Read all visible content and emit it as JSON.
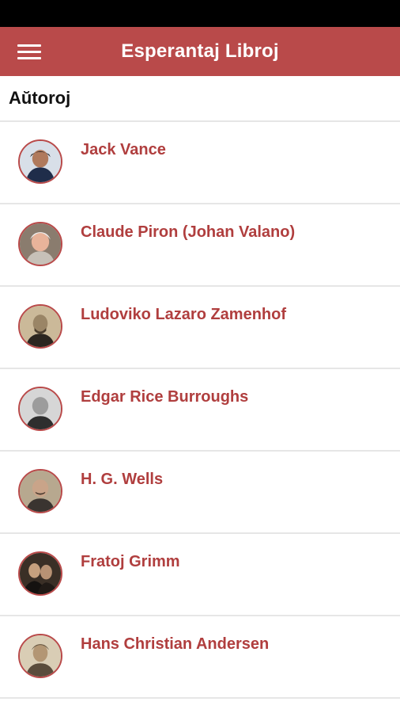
{
  "app": {
    "title": "Esperantaj Libroj",
    "accent_color": "#b94a4a",
    "menu_icon": "hamburger-menu-icon"
  },
  "section": {
    "title": "Aŭtoroj"
  },
  "authors": [
    {
      "name": "Jack Vance",
      "avatar": "portrait-photo"
    },
    {
      "name": "Claude Piron (Johan Valano)",
      "avatar": "portrait-photo"
    },
    {
      "name": "Ludoviko Lazaro Zamenhof",
      "avatar": "portrait-photo"
    },
    {
      "name": "Edgar Rice Burroughs",
      "avatar": "portrait-photo"
    },
    {
      "name": "H. G. Wells",
      "avatar": "portrait-photo"
    },
    {
      "name": "Fratoj Grimm",
      "avatar": "portrait-photo"
    },
    {
      "name": "Hans Christian Andersen",
      "avatar": "portrait-photo"
    }
  ]
}
